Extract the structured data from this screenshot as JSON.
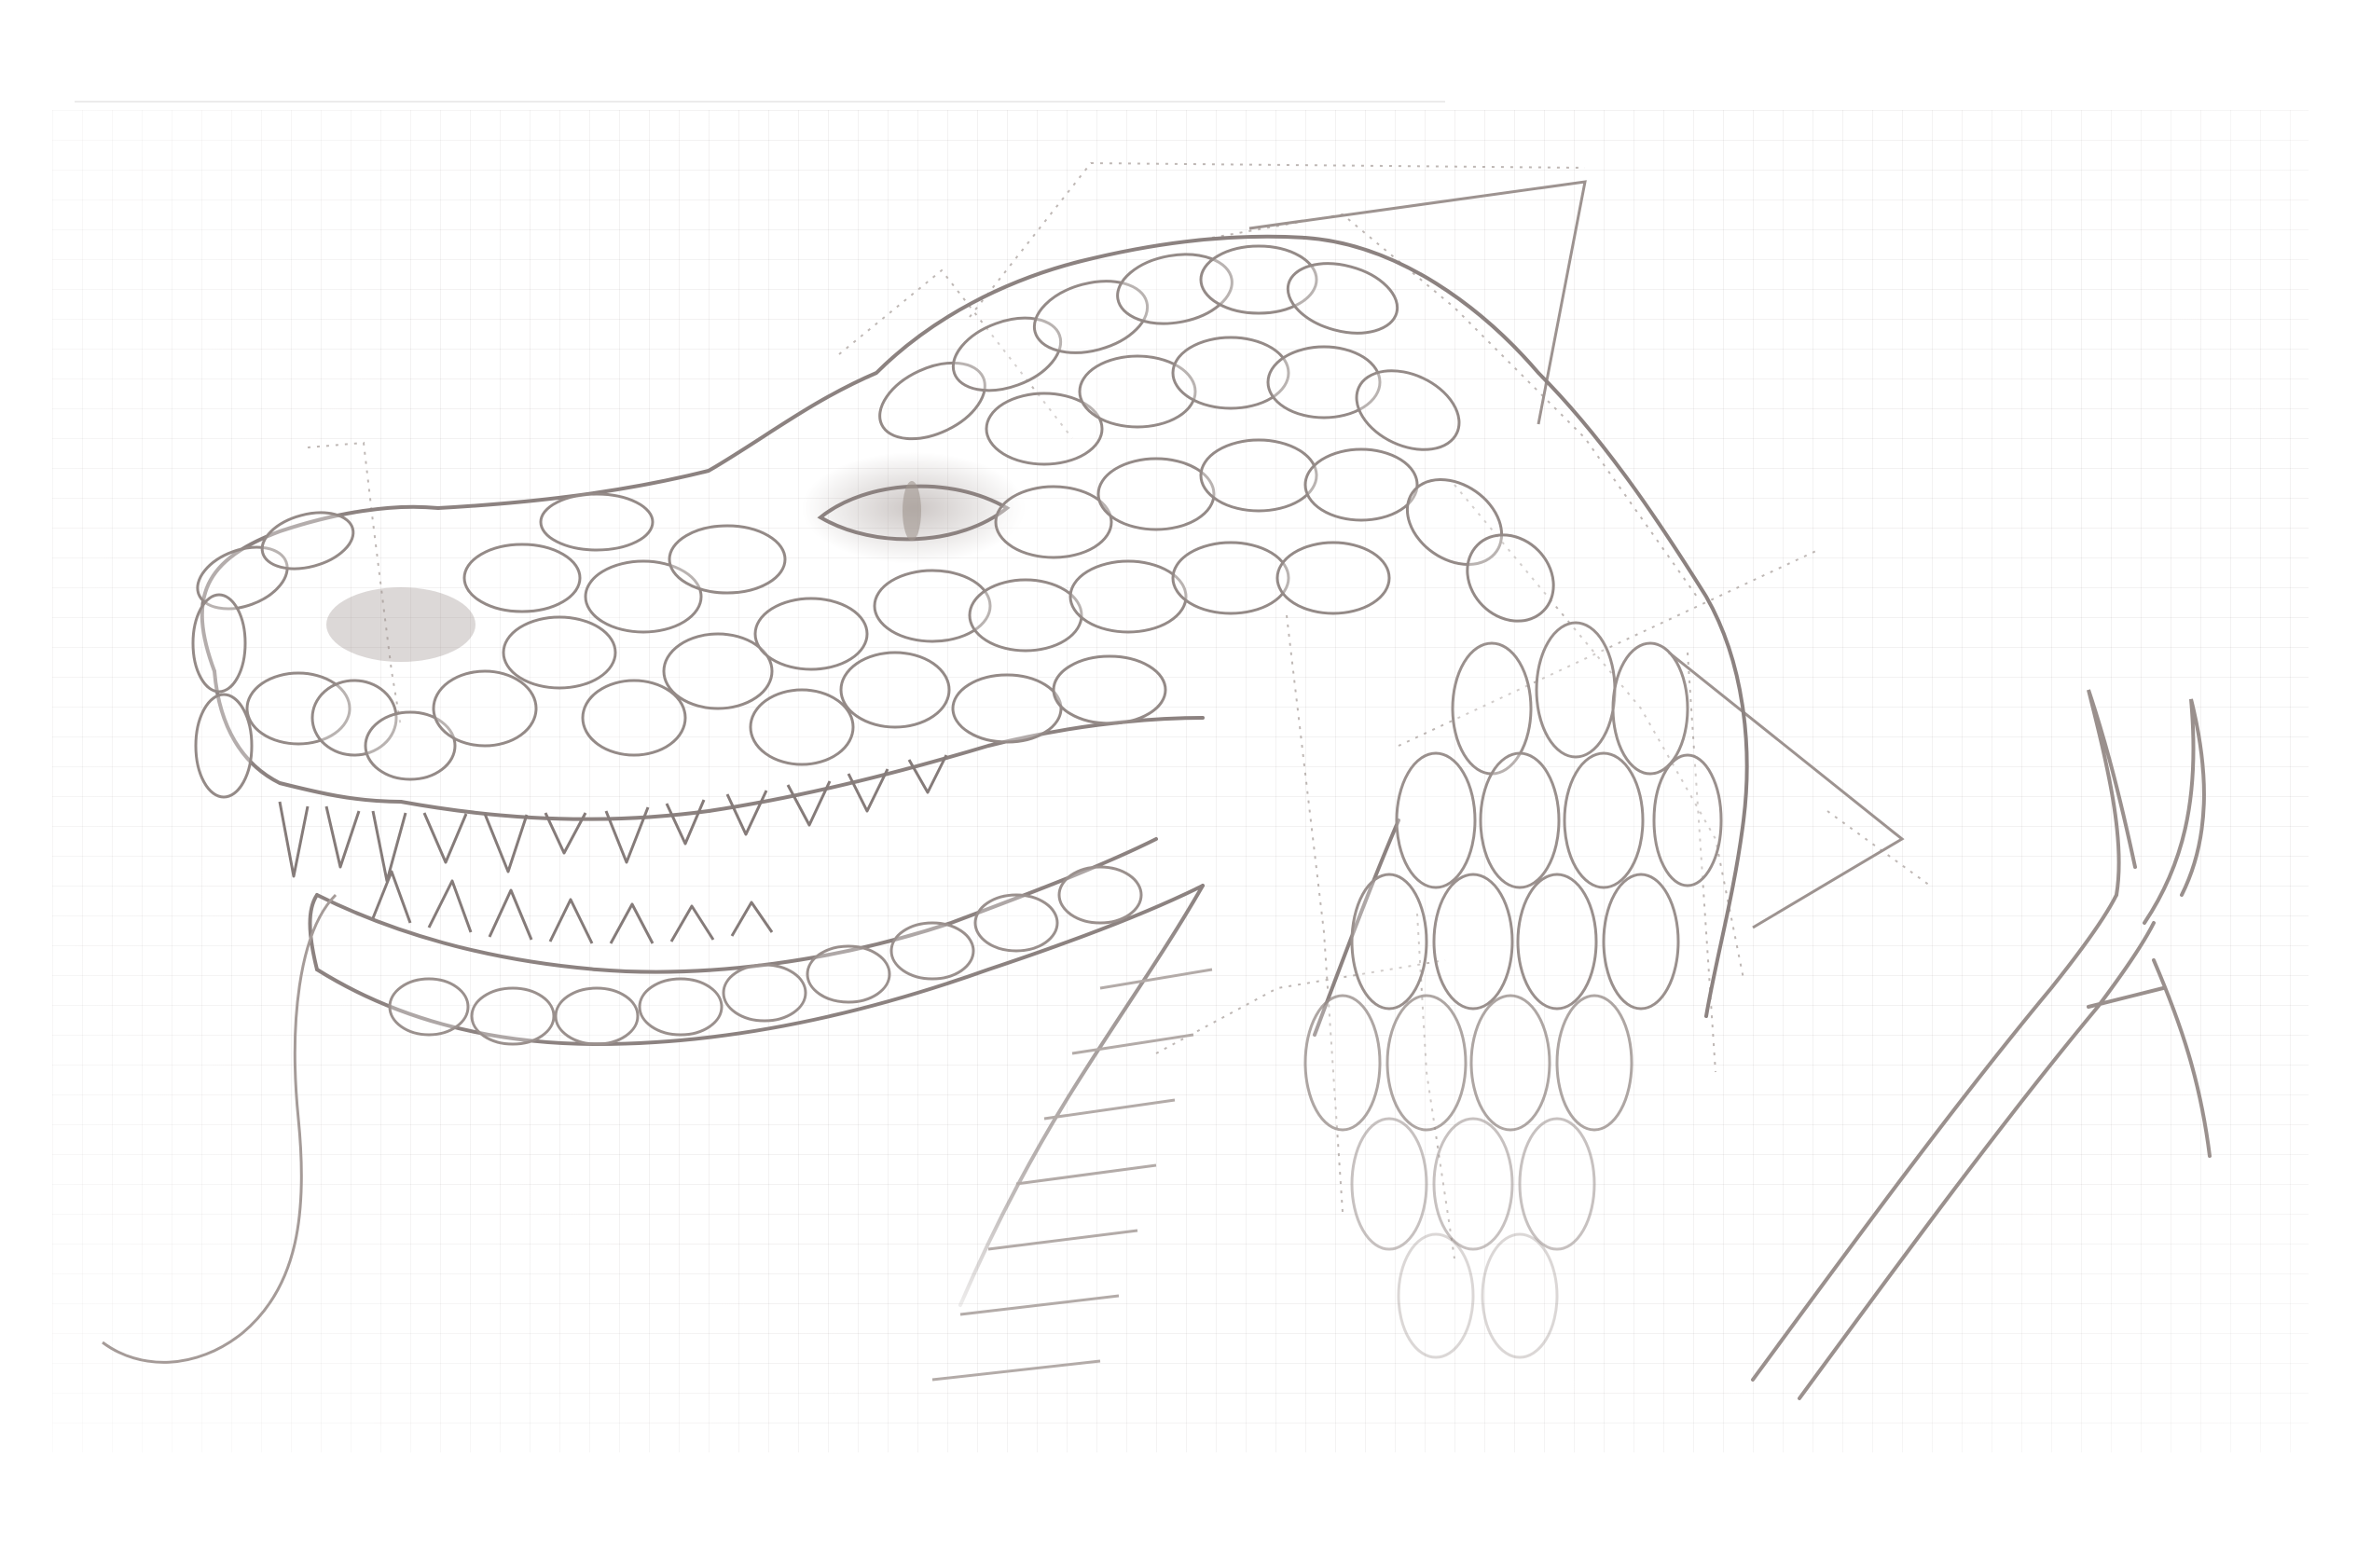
{
  "title": "",
  "colors": {
    "paper": "#ffffff",
    "grid": "#ece9e9",
    "graphite": "#8c8280",
    "graphite_light": "#b9b1ae",
    "shade": "#a79d9a",
    "guide": "#a9a09c"
  },
  "icons": {}
}
